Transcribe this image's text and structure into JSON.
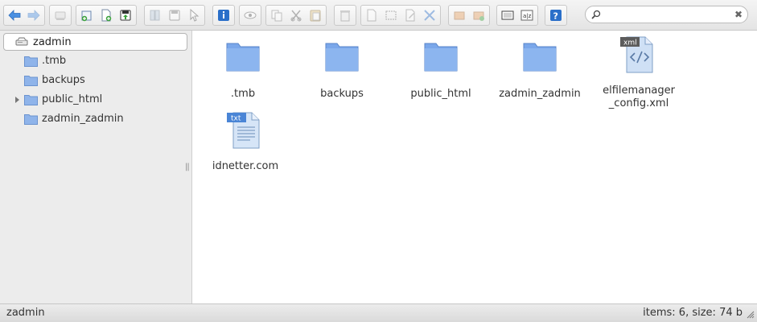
{
  "toolbar": {
    "groups": [
      {
        "name": "history",
        "buttons": [
          "back",
          "forward"
        ]
      },
      {
        "name": "home",
        "buttons": [
          "home"
        ]
      },
      {
        "name": "create",
        "buttons": [
          "mkdir",
          "mkfile",
          "upload"
        ]
      },
      {
        "name": "open",
        "buttons": [
          "open",
          "download",
          "getfile"
        ]
      },
      {
        "name": "info",
        "buttons": [
          "info"
        ]
      },
      {
        "name": "quicklook",
        "buttons": [
          "quicklook"
        ]
      },
      {
        "name": "clipboard",
        "buttons": [
          "copy",
          "cut",
          "paste"
        ]
      },
      {
        "name": "rm",
        "buttons": [
          "rm"
        ]
      },
      {
        "name": "edit",
        "buttons": [
          "duplicate",
          "rename",
          "edit",
          "resize"
        ]
      },
      {
        "name": "archive",
        "buttons": [
          "extract",
          "archive"
        ]
      },
      {
        "name": "view",
        "buttons": [
          "view",
          "sort"
        ]
      },
      {
        "name": "help",
        "buttons": [
          "help"
        ]
      }
    ],
    "search": {
      "placeholder": "",
      "value": ""
    }
  },
  "navbar": {
    "root": {
      "label": "zadmin",
      "icon": "drive-icon"
    },
    "items": [
      {
        "label": ".tmb",
        "has_children": false
      },
      {
        "label": "backups",
        "has_children": false
      },
      {
        "label": "public_html",
        "has_children": true
      },
      {
        "label": "zadmin_zadmin",
        "has_children": false
      }
    ]
  },
  "files": [
    {
      "name": ".tmb",
      "type": "folder"
    },
    {
      "name": "backups",
      "type": "folder"
    },
    {
      "name": "public_html",
      "type": "folder"
    },
    {
      "name": "zadmin_zadmin",
      "type": "folder"
    },
    {
      "name": "elfilemanager_config.xml",
      "display_name": "elfilemanager\n_config.xml",
      "type": "xml",
      "badge": "xml"
    },
    {
      "name": "idnetter.com",
      "type": "txt",
      "badge": "txt"
    }
  ],
  "statusbar": {
    "path": "zadmin",
    "info": "items: 6, size: 74 b"
  },
  "colors": {
    "folder": "#6b9be0",
    "accent": "#2a6fc9",
    "toolbar_bg": "#ececec",
    "nav_bg": "#ececec"
  }
}
